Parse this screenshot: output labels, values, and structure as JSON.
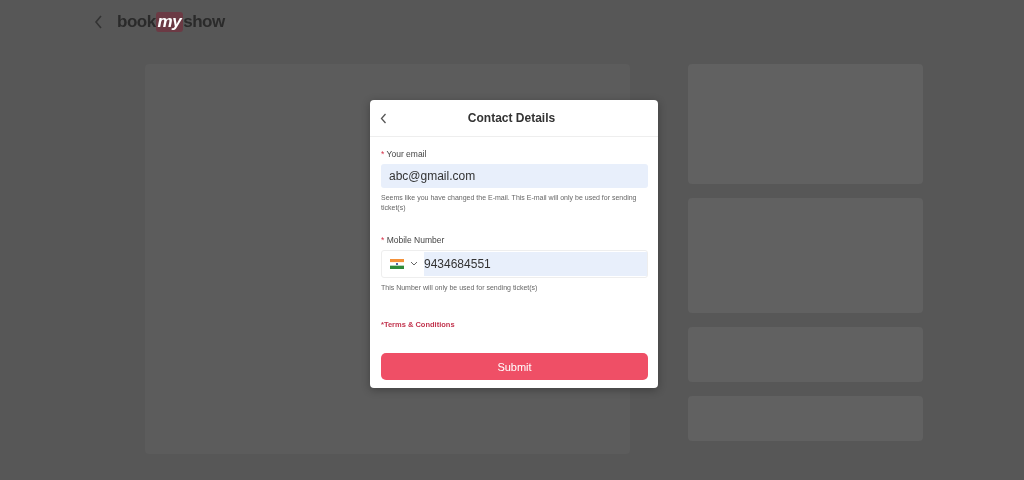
{
  "header": {
    "logo": [
      "book",
      "my",
      "show"
    ]
  },
  "dialog": {
    "title": "Contact Details",
    "email": {
      "label": "Your email",
      "required_mark": "*",
      "value": "abc@gmail.com",
      "hint": "Seems like you have changed the E-mail. This E-mail will only be used for sending ticket(s)"
    },
    "mobile": {
      "label": "Mobile Number",
      "required_mark": "*",
      "value": "9434684551",
      "hint": "This Number will only be used for sending ticket(s)"
    },
    "terms": "*Terms & Conditions",
    "submit": "Submit"
  }
}
